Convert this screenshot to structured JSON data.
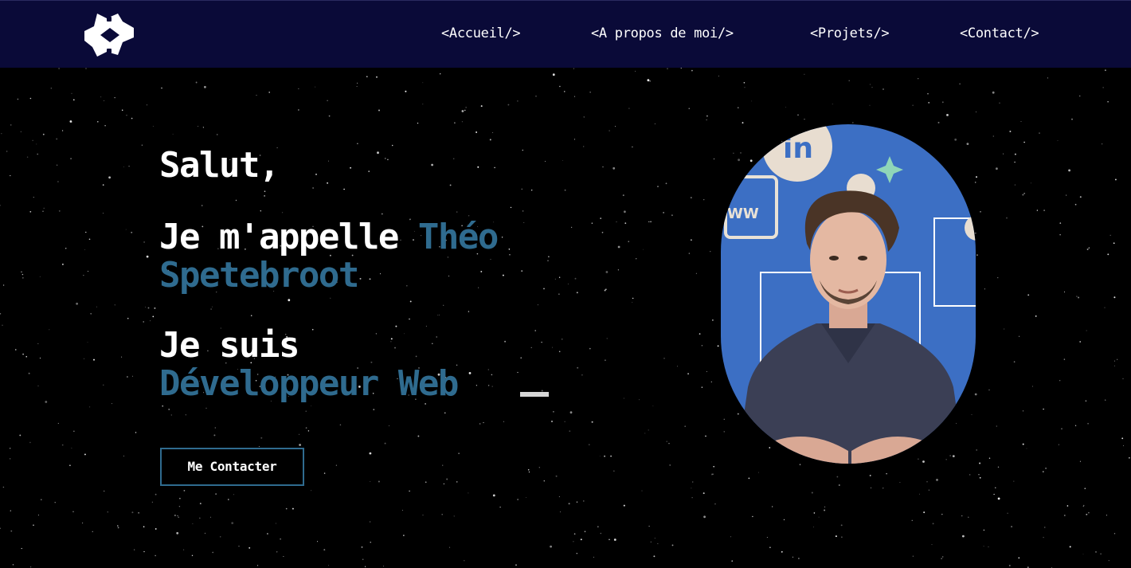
{
  "nav": {
    "logo_icon": "code-brackets-logo-icon",
    "items": [
      {
        "label": "<Accueil/>"
      },
      {
        "label": "<A propos de moi/>"
      },
      {
        "label": "<Projets/>"
      },
      {
        "label": "<Contact/>"
      }
    ]
  },
  "hero": {
    "greeting": "Salut,",
    "intro_prefix": "Je m'appelle",
    "first_name": "Théo",
    "last_name": "Spetebroot",
    "role_prefix": "Je suis",
    "role": "Développeur Web"
  },
  "cta": {
    "label": "Me Contacter"
  },
  "colors": {
    "navbar": "#0a0a38",
    "accent": "#2f6b8f",
    "background": "#000000",
    "photo_background": "#3c6fc4"
  }
}
